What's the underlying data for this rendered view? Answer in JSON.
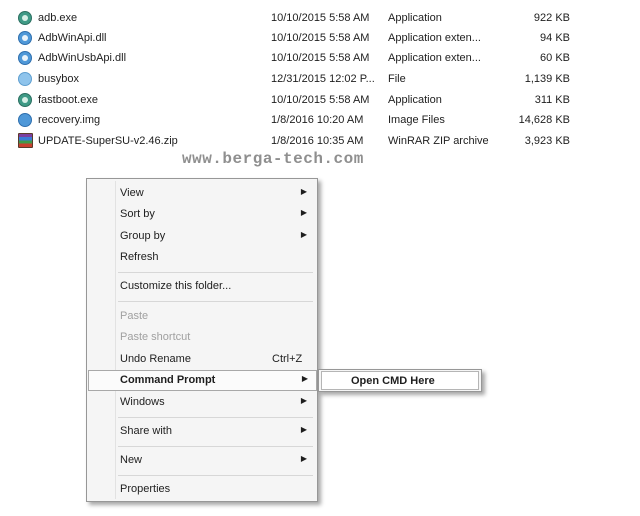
{
  "files": [
    {
      "name": "adb.exe",
      "date": "10/10/2015 5:58 AM",
      "type": "Application",
      "size": "922 KB",
      "icon": "application-icon",
      "kind": "app"
    },
    {
      "name": "AdbWinApi.dll",
      "date": "10/10/2015 5:58 AM",
      "type": "Application exten...",
      "size": "94 KB",
      "icon": "dll-icon",
      "kind": "dll"
    },
    {
      "name": "AdbWinUsbApi.dll",
      "date": "10/10/2015 5:58 AM",
      "type": "Application exten...",
      "size": "60 KB",
      "icon": "dll-icon",
      "kind": "dll"
    },
    {
      "name": "busybox",
      "date": "12/31/2015 12:02 P...",
      "type": "File",
      "size": "1,139 KB",
      "icon": "file-icon",
      "kind": "file"
    },
    {
      "name": "fastboot.exe",
      "date": "10/10/2015 5:58 AM",
      "type": "Application",
      "size": "311 KB",
      "icon": "application-icon",
      "kind": "app"
    },
    {
      "name": "recovery.img",
      "date": "1/8/2016 10:20 AM",
      "type": "Image Files",
      "size": "14,628 KB",
      "icon": "image-file-icon",
      "kind": "img"
    },
    {
      "name": "UPDATE-SuperSU-v2.46.zip",
      "date": "1/8/2016 10:35 AM",
      "type": "WinRAR ZIP archive",
      "size": "3,923 KB",
      "icon": "winrar-archive-icon",
      "kind": "zip"
    }
  ],
  "watermark": "www.berga-tech.com",
  "context_menu": {
    "items": [
      {
        "label": "View",
        "has_submenu": true
      },
      {
        "label": "Sort by",
        "has_submenu": true
      },
      {
        "label": "Group by",
        "has_submenu": true
      },
      {
        "label": "Refresh"
      },
      {
        "label": "Customize this folder..."
      },
      {
        "label": "Paste",
        "disabled": true
      },
      {
        "label": "Paste shortcut",
        "disabled": true
      },
      {
        "label": "Undo Rename",
        "shortcut": "Ctrl+Z"
      },
      {
        "label": "Command Prompt",
        "has_submenu": true,
        "active": true
      },
      {
        "label": "Windows",
        "has_submenu": true
      },
      {
        "label": "Share with",
        "has_submenu": true
      },
      {
        "label": "New",
        "has_submenu": true
      },
      {
        "label": "Properties"
      }
    ],
    "arrow_glyph": "▶"
  },
  "submenu": {
    "label": "Open CMD Here"
  }
}
